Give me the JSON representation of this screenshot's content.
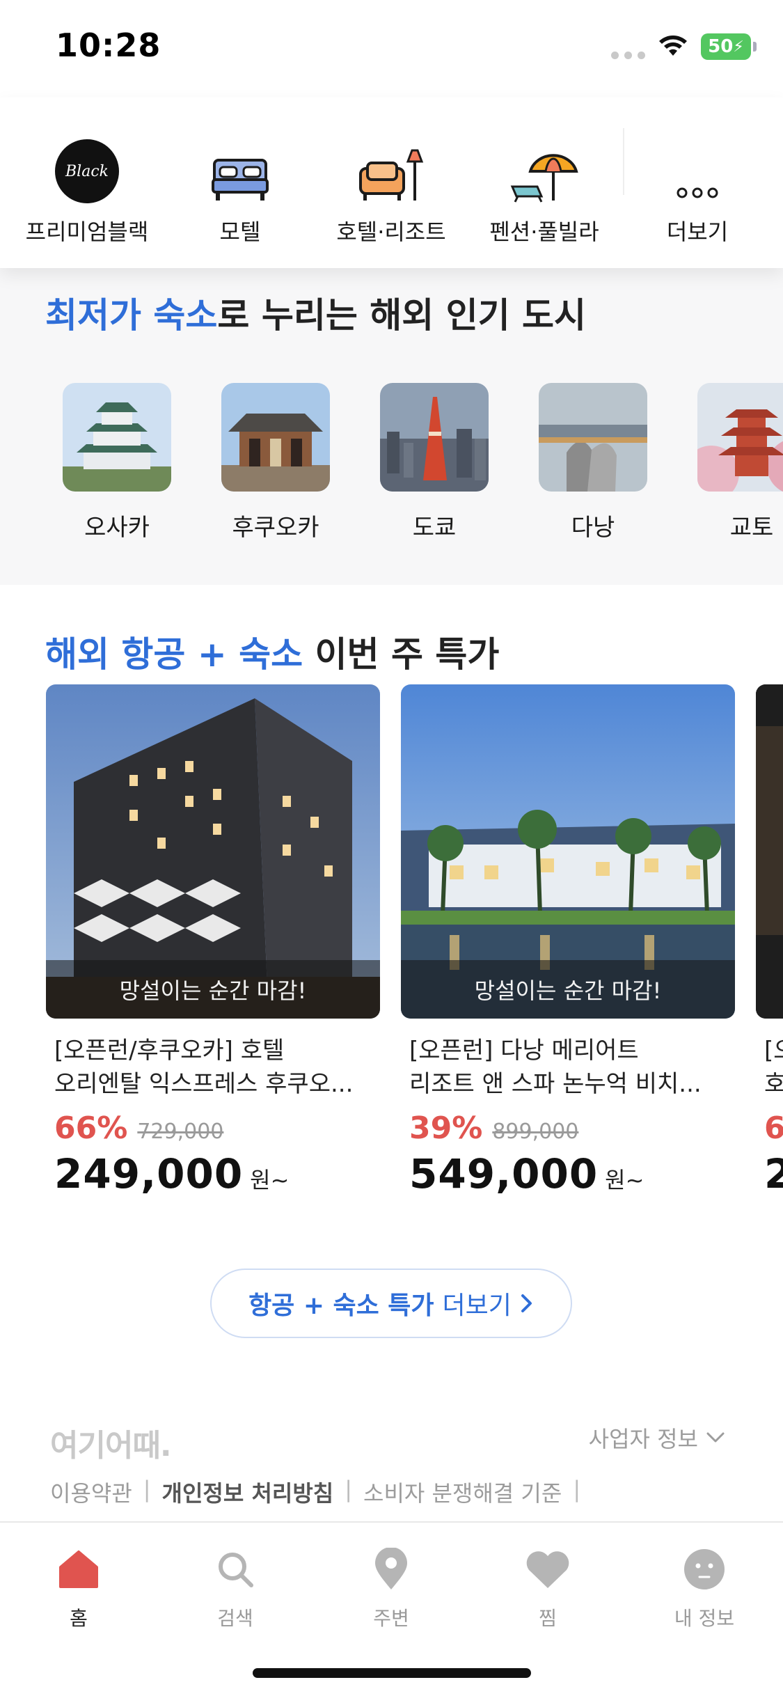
{
  "status_bar": {
    "time": "10:28",
    "battery": "50"
  },
  "categories": [
    {
      "label": "프리미엄블랙",
      "icon": "black-premium-icon",
      "logo_text": "Black"
    },
    {
      "label": "모텔",
      "icon": "bed-icon"
    },
    {
      "label": "호텔·리조트",
      "icon": "sofa-lamp-icon"
    },
    {
      "label": "펜션·풀빌라",
      "icon": "beach-umbrella-icon"
    },
    {
      "label": "더보기",
      "icon": "more-dots-icon"
    }
  ],
  "city_section": {
    "title_highlight": "최저가 숙소",
    "title_rest": "로 누리는 해외 인기 도시",
    "cities": [
      {
        "name": "오사카"
      },
      {
        "name": "후쿠오카"
      },
      {
        "name": "도쿄"
      },
      {
        "name": "다낭"
      },
      {
        "name": "교토"
      }
    ]
  },
  "deals_section": {
    "title_highlight": "해외 항공 + 숙소",
    "title_rest": " 이번 주 특가",
    "deals": [
      {
        "overlay": "망설이는 순간 마감!",
        "title_line1": "[오픈런/후쿠오카] 호텔",
        "title_line2": "오리엔탈 익스프레스 후쿠오...",
        "discount": "66%",
        "original_price": "729,000",
        "price": "249,000",
        "unit": "원~"
      },
      {
        "overlay": "망설이는 순간 마감!",
        "title_line1": "[오픈런] 다낭 메리어트",
        "title_line2": "리조트 앤 스파 논누억 비치...",
        "discount": "39%",
        "original_price": "899,000",
        "price": "549,000",
        "unit": "원~"
      },
      {
        "overlay": "",
        "title_line1": "[오",
        "title_line2": "호",
        "discount": "6",
        "original_price": "",
        "price": "2",
        "unit": ""
      }
    ],
    "more_button": {
      "strong": "항공 + 숙소 특가",
      "normal": "더보기"
    }
  },
  "footer": {
    "logo": "여기어때.",
    "business_info": "사업자 정보",
    "links": [
      "이용약관",
      "개인정보 처리방침",
      "소비자 분쟁해결 기준"
    ],
    "separator": "|"
  },
  "tab_bar": [
    {
      "label": "홈",
      "icon": "home-icon",
      "active": true
    },
    {
      "label": "검색",
      "icon": "search-icon"
    },
    {
      "label": "주변",
      "icon": "location-pin-icon"
    },
    {
      "label": "찜",
      "icon": "heart-icon"
    },
    {
      "label": "내 정보",
      "icon": "profile-icon"
    }
  ],
  "colors": {
    "accent": "#2f6ed8",
    "discount": "#e0544f",
    "tab_active": "#e0544f",
    "battery": "#53c760"
  }
}
